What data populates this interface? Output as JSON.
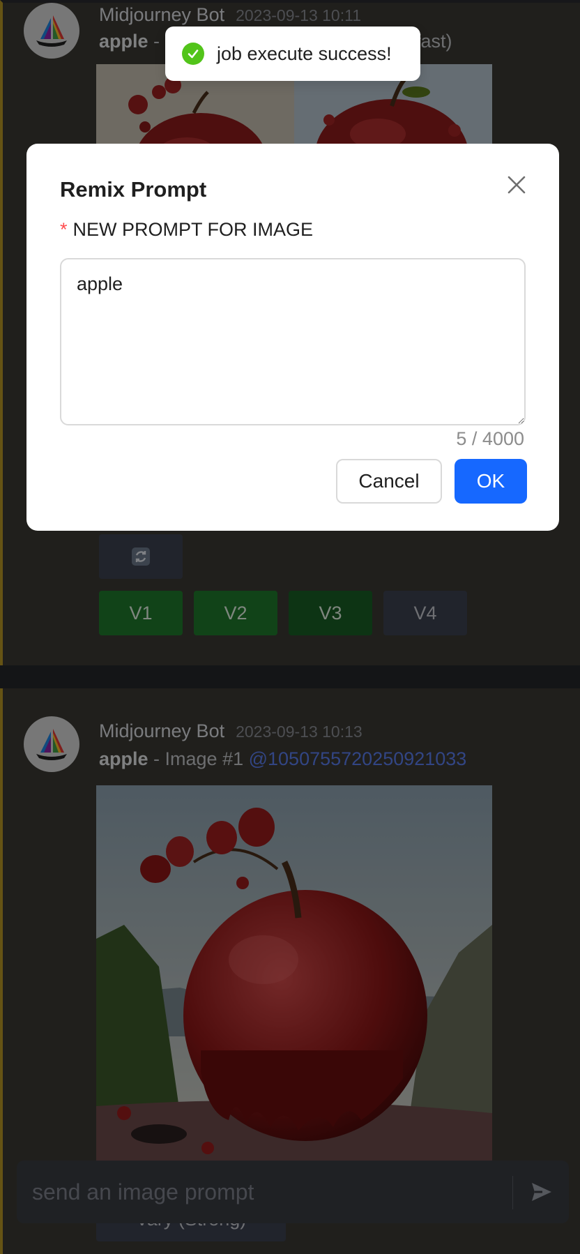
{
  "toast": {
    "message": "job execute success!",
    "icon": "check-circle-icon",
    "color": "#52c41a"
  },
  "modal": {
    "title": "Remix Prompt",
    "required_mark": "*",
    "field_label": "NEW PROMPT FOR IMAGE",
    "prompt_value": "apple",
    "counter": "5 / 4000",
    "cancel_label": "Cancel",
    "ok_label": "OK",
    "accent": "#1668ff"
  },
  "messages": [
    {
      "author": "Midjourney Bot",
      "timestamp": "2023-09-13 10:11",
      "prompt": "apple",
      "text_left": " - ",
      "text_right": "fast)",
      "buttons": {
        "variations": [
          "V1",
          "V2",
          "V3",
          "V4"
        ]
      }
    },
    {
      "author": "Midjourney Bot",
      "timestamp": "2023-09-13 10:13",
      "prompt": "apple",
      "suffix": " - Image #1 ",
      "mention": "@1050755720250921033",
      "under_button": "Vary (Strong)"
    }
  ],
  "composer": {
    "placeholder": "send an image prompt",
    "send_icon": "send-icon"
  }
}
